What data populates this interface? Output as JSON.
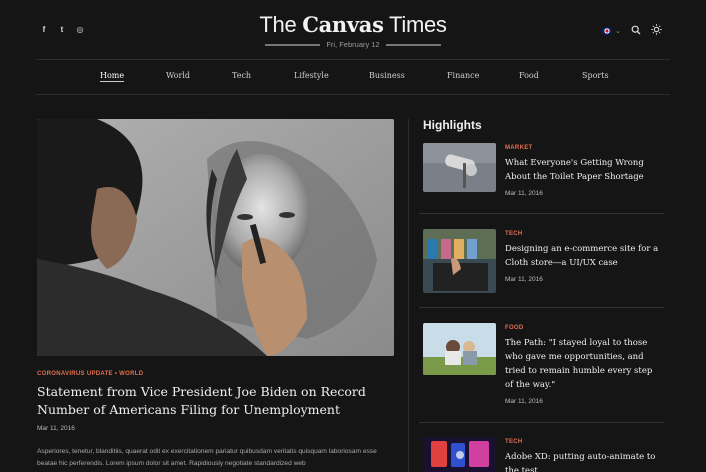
{
  "header": {
    "social": [
      {
        "icon": "facebook-icon",
        "glyph": "f"
      },
      {
        "icon": "twitter-icon",
        "glyph": "t"
      },
      {
        "icon": "instagram-icon",
        "glyph": "◎"
      }
    ],
    "title_light": "The ",
    "title_bold": "Canvas",
    "title_rest": " Times",
    "date": "Fri, February 12",
    "language_icon": "uk-flag-icon",
    "search_icon": "search-icon",
    "theme_icon": "sun-icon"
  },
  "nav": {
    "items": [
      {
        "label": "Home",
        "active": true
      },
      {
        "label": "World"
      },
      {
        "label": "Tech"
      },
      {
        "label": "Lifestyle"
      },
      {
        "label": "Business"
      },
      {
        "label": "Finance"
      },
      {
        "label": "Food"
      },
      {
        "label": "Sports"
      }
    ]
  },
  "hero": {
    "kicker": "CORONAVIRUS UPDATE • WORLD",
    "title": "Statement from Vice President Joe Biden on Record Number of Americans Filing for Unemployment",
    "date": "Mar 11, 2016",
    "excerpt": "Asperiores, tenetur, blanditiis, quaerat odit ex exercitationem pariatur quibusdam veritatis quisquam laboriosam esse beatae hic perferendis. Lorem ipsum dolor sit amet. Rapidiously negotiate standardized web"
  },
  "highlights": {
    "heading": "Highlights",
    "items": [
      {
        "kicker": "MARKET",
        "title": "What Everyone's Getting Wrong About the Toilet Paper Shortage",
        "date": "Mar 11, 2016"
      },
      {
        "kicker": "TECH",
        "title": "Designing an e-commerce site for a Cloth store—a UI/UX case",
        "date": "Mar 11, 2016"
      },
      {
        "kicker": "FOOD",
        "title": "The Path: \"I stayed loyal to those who gave me opportunities, and tried to remain humble every step of the way.\"",
        "date": "Mar 11, 2016"
      },
      {
        "kicker": "TECH",
        "title": "Adobe XD: putting auto-animate to the test",
        "date": ""
      }
    ]
  },
  "colors": {
    "background": "#151515",
    "accent": "#e0704f",
    "text": "#f0f0f0"
  }
}
